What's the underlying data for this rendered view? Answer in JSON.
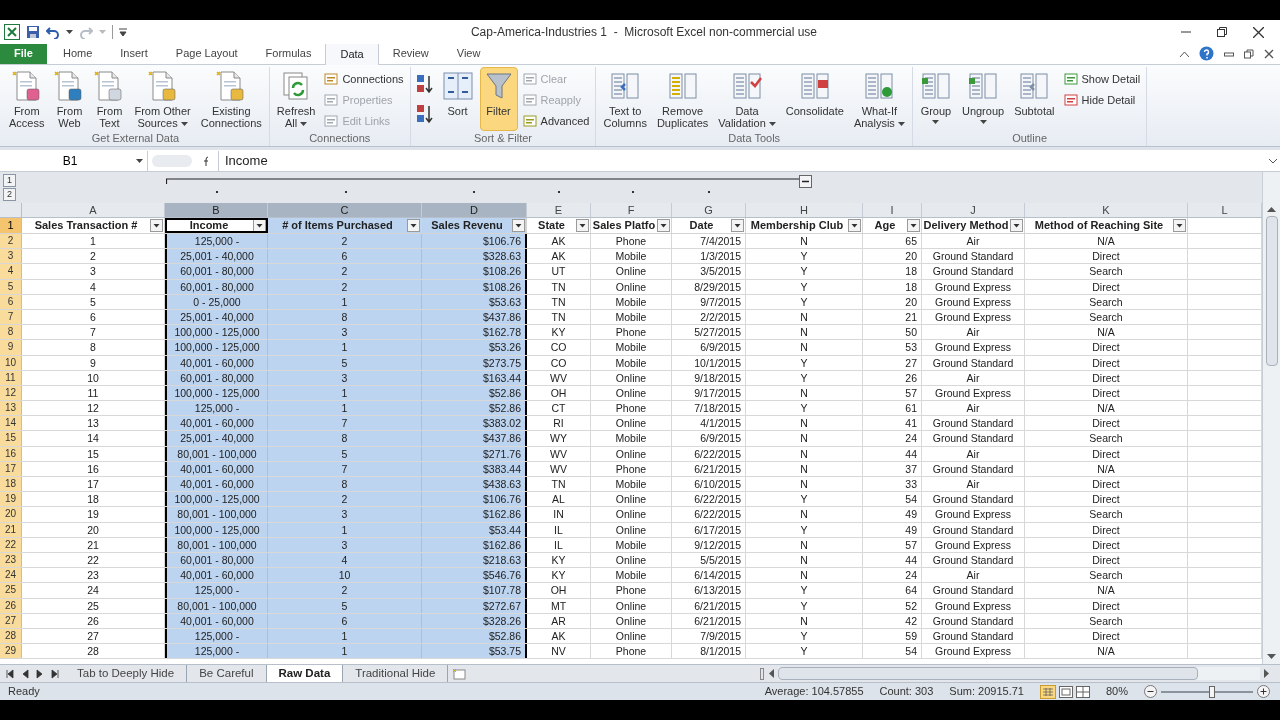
{
  "window": {
    "title": "Cap-America-Industries 1  -  Microsoft Excel non-commercial use"
  },
  "ribbon_tabs": [
    {
      "label": "File",
      "selected": false
    },
    {
      "label": "Home",
      "selected": false
    },
    {
      "label": "Insert",
      "selected": false
    },
    {
      "label": "Page Layout",
      "selected": false
    },
    {
      "label": "Formulas",
      "selected": false
    },
    {
      "label": "Data",
      "selected": true
    },
    {
      "label": "Review",
      "selected": false
    },
    {
      "label": "View",
      "selected": false
    }
  ],
  "ribbon_groups": [
    {
      "label": "Get External Data",
      "buttons": [
        {
          "kind": "large",
          "lines": [
            "From",
            "Access"
          ],
          "disabled": false,
          "on": false
        },
        {
          "kind": "large",
          "lines": [
            "From",
            "Web"
          ],
          "disabled": false,
          "on": false
        },
        {
          "kind": "large",
          "lines": [
            "From",
            "Text"
          ],
          "disabled": false,
          "on": false
        },
        {
          "kind": "large",
          "lines": [
            "From Other",
            "Sources"
          ],
          "menu": true,
          "disabled": false,
          "on": false
        },
        {
          "kind": "large",
          "lines": [
            "Existing",
            "Connections"
          ],
          "disabled": false,
          "on": false
        }
      ]
    },
    {
      "label": "Connections",
      "buttons": [
        {
          "kind": "large",
          "lines": [
            "Refresh",
            "All"
          ],
          "menu": true,
          "disabled": false,
          "on": false
        },
        {
          "kind": "small",
          "lines": [
            "Connections"
          ],
          "disabled": false,
          "on": false
        },
        {
          "kind": "small",
          "lines": [
            "Properties"
          ],
          "disabled": true,
          "on": false
        },
        {
          "kind": "small",
          "lines": [
            "Edit Links"
          ],
          "disabled": true,
          "on": false
        }
      ]
    },
    {
      "label": "Sort & Filter",
      "buttons": [
        {
          "kind": "icon",
          "disabled": false,
          "on": false
        },
        {
          "kind": "icon",
          "disabled": false,
          "on": false
        },
        {
          "kind": "large",
          "lines": [
            "Sort"
          ],
          "disabled": false,
          "on": false
        },
        {
          "kind": "large",
          "lines": [
            "Filter"
          ],
          "disabled": false,
          "on": true
        },
        {
          "kind": "small",
          "lines": [
            "Clear"
          ],
          "disabled": true,
          "on": false
        },
        {
          "kind": "small",
          "lines": [
            "Reapply"
          ],
          "disabled": true,
          "on": false
        },
        {
          "kind": "small",
          "lines": [
            "Advanced"
          ],
          "disabled": false,
          "on": false
        }
      ]
    },
    {
      "label": "Data Tools",
      "buttons": [
        {
          "kind": "large",
          "lines": [
            "Text to",
            "Columns"
          ],
          "disabled": false,
          "on": false
        },
        {
          "kind": "large",
          "lines": [
            "Remove",
            "Duplicates"
          ],
          "disabled": false,
          "on": false
        },
        {
          "kind": "large",
          "lines": [
            "Data",
            "Validation"
          ],
          "menu": true,
          "disabled": false,
          "on": false
        },
        {
          "kind": "large",
          "lines": [
            "Consolidate"
          ],
          "disabled": false,
          "on": false
        },
        {
          "kind": "large",
          "lines": [
            "What-If",
            "Analysis"
          ],
          "menu": true,
          "disabled": false,
          "on": false
        }
      ]
    },
    {
      "label": "Outline",
      "buttons": [
        {
          "kind": "large",
          "lines": [
            "Group"
          ],
          "menu": true,
          "disabled": false,
          "on": false
        },
        {
          "kind": "large",
          "lines": [
            "Ungroup"
          ],
          "menu": true,
          "disabled": false,
          "on": false
        },
        {
          "kind": "large",
          "lines": [
            "Subtotal"
          ],
          "disabled": false,
          "on": false
        },
        {
          "kind": "small",
          "lines": [
            "Show Detail"
          ],
          "disabled": false,
          "on": false
        },
        {
          "kind": "small",
          "lines": [
            "Hide Detail"
          ],
          "disabled": false,
          "on": false
        }
      ]
    }
  ],
  "formula_bar": {
    "name_box": "B1",
    "formula": "Income"
  },
  "outline_levels": [
    "1",
    "2"
  ],
  "columns": [
    {
      "letter": "A",
      "selected": false
    },
    {
      "letter": "B",
      "selected": true
    },
    {
      "letter": "C",
      "selected": true
    },
    {
      "letter": "D",
      "selected": true
    },
    {
      "letter": "E",
      "selected": false
    },
    {
      "letter": "F",
      "selected": false
    },
    {
      "letter": "G",
      "selected": false
    },
    {
      "letter": "H",
      "selected": false
    },
    {
      "letter": "I",
      "selected": false
    },
    {
      "letter": "J",
      "selected": false
    },
    {
      "letter": "K",
      "selected": false
    },
    {
      "letter": "L",
      "selected": false
    }
  ],
  "header_row": {
    "number": "1",
    "cells": [
      {
        "text": "Sales Transaction #",
        "active": false
      },
      {
        "text": "Income",
        "active": true
      },
      {
        "text": "# of Items Purchased",
        "active": false
      },
      {
        "text": "Sales Revenu",
        "active": false
      },
      {
        "text": "State",
        "active": false
      },
      {
        "text": "Sales Platfo",
        "active": false
      },
      {
        "text": "Date",
        "active": false
      },
      {
        "text": "Membership Club",
        "active": false
      },
      {
        "text": "Age",
        "active": false
      },
      {
        "text": "Delivery Method",
        "active": false
      },
      {
        "text": "Method of Reaching Site",
        "active": false
      }
    ]
  },
  "rows": [
    {
      "number": "2",
      "cells": [
        "1",
        "125,000 -",
        "2",
        "$106.76",
        "AK",
        "Phone",
        "7/4/2015",
        "N",
        "65",
        "Air",
        "N/A"
      ]
    },
    {
      "number": "3",
      "cells": [
        "2",
        "25,001 - 40,000",
        "6",
        "$328.63",
        "AK",
        "Mobile",
        "1/3/2015",
        "Y",
        "20",
        "Ground Standard",
        "Direct"
      ]
    },
    {
      "number": "4",
      "cells": [
        "3",
        "60,001 - 80,000",
        "2",
        "$108.26",
        "UT",
        "Online",
        "3/5/2015",
        "Y",
        "18",
        "Ground Standard",
        "Search"
      ]
    },
    {
      "number": "5",
      "cells": [
        "4",
        "60,001 - 80,000",
        "2",
        "$108.26",
        "TN",
        "Online",
        "8/29/2015",
        "Y",
        "18",
        "Ground Express",
        "Direct"
      ]
    },
    {
      "number": "6",
      "cells": [
        "5",
        "0 - 25,000",
        "1",
        "$53.63",
        "TN",
        "Mobile",
        "9/7/2015",
        "Y",
        "20",
        "Ground Express",
        "Search"
      ]
    },
    {
      "number": "7",
      "cells": [
        "6",
        "25,001 - 40,000",
        "8",
        "$437.86",
        "TN",
        "Mobile",
        "2/2/2015",
        "N",
        "21",
        "Ground Express",
        "Search"
      ]
    },
    {
      "number": "8",
      "cells": [
        "7",
        "100,000 - 125,000",
        "3",
        "$162.78",
        "KY",
        "Phone",
        "5/27/2015",
        "N",
        "50",
        "Air",
        "N/A"
      ]
    },
    {
      "number": "9",
      "cells": [
        "8",
        "100,000 - 125,000",
        "1",
        "$53.26",
        "CO",
        "Mobile",
        "6/9/2015",
        "N",
        "53",
        "Ground Express",
        "Direct"
      ]
    },
    {
      "number": "10",
      "cells": [
        "9",
        "40,001 - 60,000",
        "5",
        "$273.75",
        "CO",
        "Mobile",
        "10/1/2015",
        "Y",
        "27",
        "Ground Standard",
        "Direct"
      ]
    },
    {
      "number": "11",
      "cells": [
        "10",
        "60,001 - 80,000",
        "3",
        "$163.44",
        "WV",
        "Online",
        "9/18/2015",
        "Y",
        "26",
        "Air",
        "Direct"
      ]
    },
    {
      "number": "12",
      "cells": [
        "11",
        "100,000 - 125,000",
        "1",
        "$52.86",
        "OH",
        "Online",
        "9/17/2015",
        "N",
        "57",
        "Ground Express",
        "Direct"
      ]
    },
    {
      "number": "13",
      "cells": [
        "12",
        "125,000 -",
        "1",
        "$52.86",
        "CT",
        "Phone",
        "7/18/2015",
        "Y",
        "61",
        "Air",
        "N/A"
      ]
    },
    {
      "number": "14",
      "cells": [
        "13",
        "40,001 - 60,000",
        "7",
        "$383.02",
        "RI",
        "Online",
        "4/1/2015",
        "N",
        "41",
        "Ground Standard",
        "Direct"
      ]
    },
    {
      "number": "15",
      "cells": [
        "14",
        "25,001 - 40,000",
        "8",
        "$437.86",
        "WY",
        "Mobile",
        "6/9/2015",
        "N",
        "24",
        "Ground Standard",
        "Search"
      ]
    },
    {
      "number": "16",
      "cells": [
        "15",
        "80,001 - 100,000",
        "5",
        "$271.76",
        "WV",
        "Online",
        "6/22/2015",
        "N",
        "44",
        "Air",
        "Direct"
      ]
    },
    {
      "number": "17",
      "cells": [
        "16",
        "40,001 - 60,000",
        "7",
        "$383.44",
        "WV",
        "Phone",
        "6/21/2015",
        "N",
        "37",
        "Ground Standard",
        "N/A"
      ]
    },
    {
      "number": "18",
      "cells": [
        "17",
        "40,001 - 60,000",
        "8",
        "$438.63",
        "TN",
        "Mobile",
        "6/10/2015",
        "N",
        "33",
        "Air",
        "Direct"
      ]
    },
    {
      "number": "19",
      "cells": [
        "18",
        "100,000 - 125,000",
        "2",
        "$106.76",
        "AL",
        "Online",
        "6/22/2015",
        "Y",
        "54",
        "Ground Standard",
        "Direct"
      ]
    },
    {
      "number": "20",
      "cells": [
        "19",
        "80,001 - 100,000",
        "3",
        "$162.86",
        "IN",
        "Online",
        "6/22/2015",
        "N",
        "49",
        "Ground Express",
        "Search"
      ]
    },
    {
      "number": "21",
      "cells": [
        "20",
        "100,000 - 125,000",
        "1",
        "$53.44",
        "IL",
        "Online",
        "6/17/2015",
        "Y",
        "49",
        "Ground Standard",
        "Direct"
      ]
    },
    {
      "number": "22",
      "cells": [
        "21",
        "80,001 - 100,000",
        "3",
        "$162.86",
        "IL",
        "Mobile",
        "9/12/2015",
        "N",
        "57",
        "Ground Express",
        "Direct"
      ]
    },
    {
      "number": "23",
      "cells": [
        "22",
        "60,001 - 80,000",
        "4",
        "$218.63",
        "KY",
        "Online",
        "5/5/2015",
        "N",
        "44",
        "Ground Standard",
        "Direct"
      ]
    },
    {
      "number": "24",
      "cells": [
        "23",
        "40,001 - 60,000",
        "10",
        "$546.76",
        "KY",
        "Mobile",
        "6/14/2015",
        "N",
        "24",
        "Air",
        "Search"
      ]
    },
    {
      "number": "25",
      "cells": [
        "24",
        "125,000 -",
        "2",
        "$107.78",
        "OH",
        "Phone",
        "6/13/2015",
        "Y",
        "64",
        "Ground Standard",
        "N/A"
      ]
    },
    {
      "number": "26",
      "cells": [
        "25",
        "80,001 - 100,000",
        "5",
        "$272.67",
        "MT",
        "Online",
        "6/21/2015",
        "Y",
        "52",
        "Ground Express",
        "Direct"
      ]
    },
    {
      "number": "27",
      "cells": [
        "26",
        "40,001 - 60,000",
        "6",
        "$328.26",
        "AR",
        "Online",
        "6/21/2015",
        "N",
        "42",
        "Ground Standard",
        "Search"
      ]
    },
    {
      "number": "28",
      "cells": [
        "27",
        "125,000 -",
        "1",
        "$52.86",
        "AK",
        "Online",
        "7/9/2015",
        "Y",
        "59",
        "Ground Standard",
        "Direct"
      ]
    },
    {
      "number": "29",
      "cells": [
        "28",
        "125,000 -",
        "1",
        "$53.75",
        "NV",
        "Phone",
        "8/1/2015",
        "Y",
        "54",
        "Ground Express",
        "N/A"
      ]
    }
  ],
  "sheet_tabs": [
    {
      "label": "Tab to Deeply Hide",
      "selected": false
    },
    {
      "label": "Be Careful",
      "selected": false
    },
    {
      "label": "Raw Data",
      "selected": true
    },
    {
      "label": "Traditional Hide",
      "selected": false
    }
  ],
  "status_bar": {
    "mode": "Ready",
    "average": "Average: 104.57855",
    "count": "Count: 303",
    "sum": "Sum: 20915.71",
    "zoom": "80%",
    "zoom_level": {
      "level": 0.55
    }
  }
}
